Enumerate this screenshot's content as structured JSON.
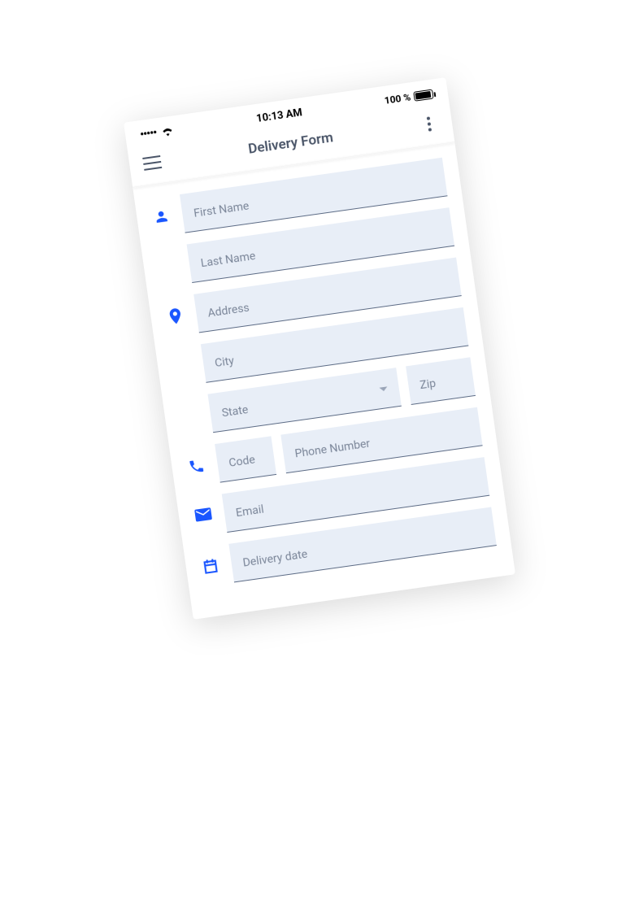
{
  "status": {
    "time": "10:13 AM",
    "battery_text": "100 %"
  },
  "header": {
    "title": "Delivery Form"
  },
  "form": {
    "first_name": "First Name",
    "last_name": "Last Name",
    "address": "Address",
    "city": "City",
    "state": "State",
    "zip": "Zip",
    "code": "Code",
    "phone": "Phone Number",
    "email": "Email",
    "delivery_date": "Delivery date"
  }
}
